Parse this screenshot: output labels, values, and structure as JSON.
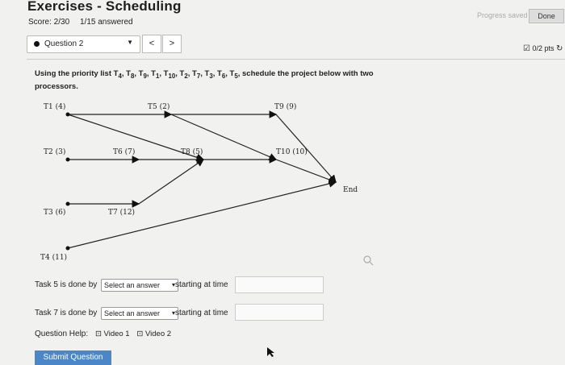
{
  "header": {
    "title": "Exercises - Scheduling",
    "score": "Score: 2/30",
    "answered": "1/15 answered",
    "progress_saved": "Progress saved",
    "done": "Done"
  },
  "question_nav": {
    "selected": "Question 2",
    "prev": "<",
    "next": ">"
  },
  "points": "0/2 pts",
  "prompt": "Using the priority list T4, T8, T9, T1, T10, T2, T7, T3, T6, T5, schedule the project below with two processors.",
  "diagram": {
    "nodes": [
      "T1 (4)",
      "T5 (2)",
      "T9 (9)",
      "T2 (3)",
      "T6 (7)",
      "T8 (5)",
      "T10 (10)",
      "End",
      "T3 (6)",
      "T7 (12)",
      "T4 (11)"
    ]
  },
  "questions": [
    {
      "prefix": "Task 5 is done by",
      "select": "Select an answer",
      "suffix": "starting at time",
      "value": ""
    },
    {
      "prefix": "Task 7 is done by",
      "select": "Select an answer",
      "suffix": "starting at time",
      "value": ""
    }
  ],
  "help": {
    "label": "Question Help:",
    "video1": "Video 1",
    "video2": "Video 2"
  },
  "submit": "Submit Question"
}
